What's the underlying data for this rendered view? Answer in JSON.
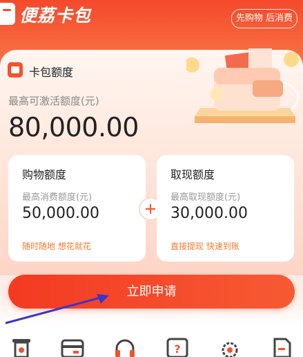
{
  "header": {
    "brand": "便荔卡包",
    "slogan": "先购物 后消费"
  },
  "card": {
    "title": "卡包额度",
    "max_label": "最高可激活额度(元)",
    "amount": "80,000.00"
  },
  "shopping": {
    "title": "购物额度",
    "label": "最高消费额度(元)",
    "amount": "50,000.00",
    "note": "随时随地 想花就花"
  },
  "cash": {
    "title": "取现额度",
    "label": "最高取现额度(元)",
    "amount": "30,000.00",
    "note": "直接提现 快速到账"
  },
  "apply_button": "立即申请",
  "colors": {
    "brand": "#f4492b",
    "accent_text": "#f4792e"
  },
  "bottom_icons": [
    "receipt-icon",
    "card-icon",
    "headset-icon",
    "help-icon",
    "settings-icon",
    "document-edit-icon"
  ]
}
